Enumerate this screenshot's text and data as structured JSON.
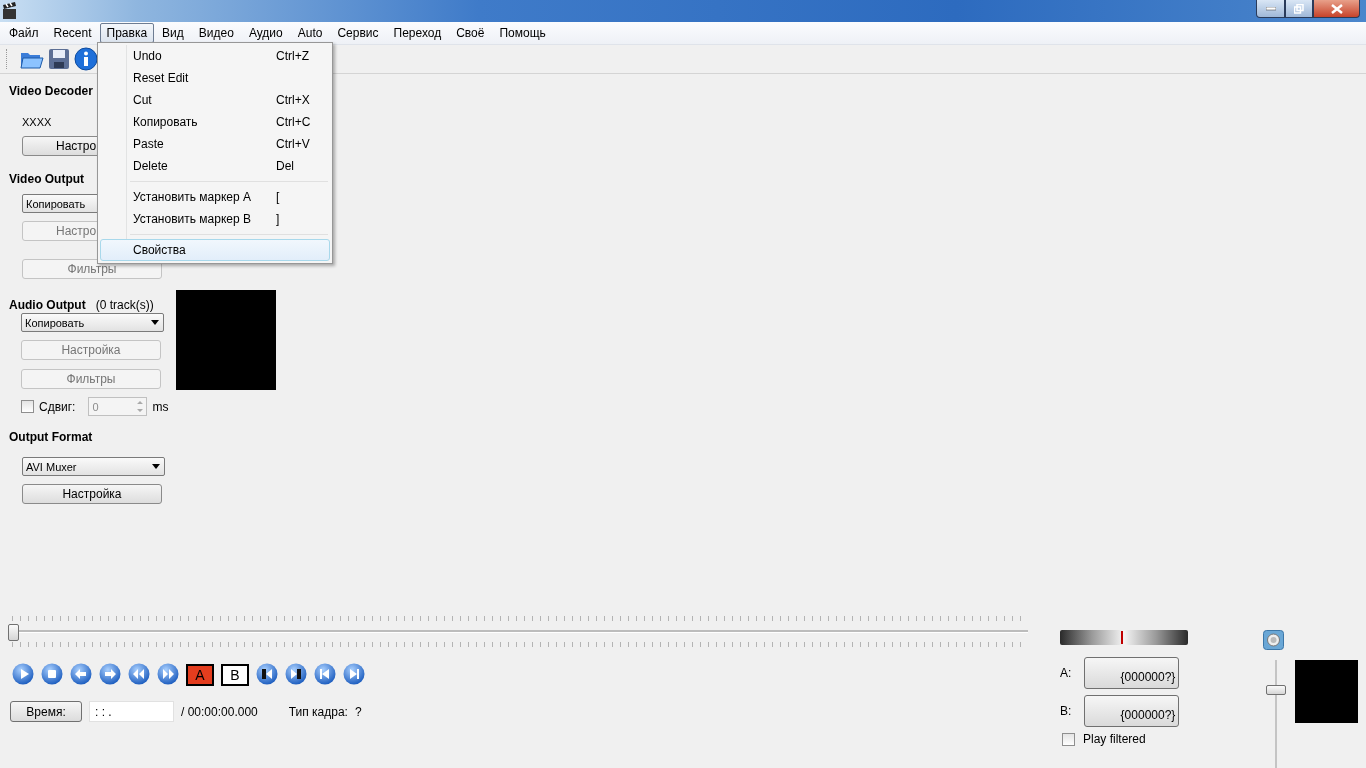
{
  "menubar": [
    {
      "label": "Файл",
      "selected": false
    },
    {
      "label": "Recent",
      "selected": false
    },
    {
      "label": "Правка",
      "selected": true
    },
    {
      "label": "Вид",
      "selected": false
    },
    {
      "label": "Видео",
      "selected": false
    },
    {
      "label": "Аудио",
      "selected": false
    },
    {
      "label": "Auto",
      "selected": false
    },
    {
      "label": "Сервис",
      "selected": false
    },
    {
      "label": "Переход",
      "selected": false
    },
    {
      "label": "Своё",
      "selected": false
    },
    {
      "label": "Помощь",
      "selected": false
    }
  ],
  "edit_menu": [
    {
      "kind": "item",
      "label": "Undo",
      "shortcut": "Ctrl+Z",
      "selected": false
    },
    {
      "kind": "item",
      "label": "Reset Edit",
      "selected": false
    },
    {
      "kind": "item",
      "label": "Cut",
      "shortcut": "Ctrl+X",
      "selected": false
    },
    {
      "kind": "item",
      "label": "Копировать",
      "shortcut": "Ctrl+C",
      "selected": false
    },
    {
      "kind": "item",
      "label": "Paste",
      "shortcut": "Ctrl+V",
      "selected": false
    },
    {
      "kind": "item",
      "label": "Delete",
      "shortcut": "Del",
      "selected": false
    },
    {
      "kind": "separator"
    },
    {
      "kind": "item",
      "label": "Установить маркер A",
      "shortcut": "[",
      "selected": false
    },
    {
      "kind": "item",
      "label": "Установить маркер B",
      "shortcut": "]",
      "selected": false
    },
    {
      "kind": "separator"
    },
    {
      "kind": "item",
      "label": "Свойства",
      "selected": true
    }
  ],
  "video_decoder": {
    "title": "Video Decoder",
    "codec": "XXXX",
    "configure_button": {
      "label": "Настро",
      "disabled": false
    }
  },
  "video_output": {
    "title": "Video Output",
    "codec_select": "Копировать",
    "configure_button": {
      "label": "Настро",
      "disabled": true
    },
    "filters_button": {
      "label": "Фильтры",
      "disabled": true
    }
  },
  "audio_output": {
    "title": "Audio Output",
    "tracks": "(0 track(s))",
    "codec_select": "Копировать",
    "configure_button": {
      "label": "Настройка",
      "disabled": true
    },
    "filters_button": {
      "label": "Фильтры",
      "disabled": true
    },
    "shift": {
      "label": "Сдвиг:",
      "checked": false,
      "value": "0",
      "unit": "ms"
    }
  },
  "output_format": {
    "title": "Output Format",
    "muxer_select": "AVI Muxer",
    "configure_button": {
      "label": "Настройка",
      "disabled": false
    }
  },
  "playback": {
    "position": {
      "level": 0
    },
    "transport": [
      {
        "kind": "play"
      },
      {
        "kind": "stop"
      },
      {
        "kind": "back"
      },
      {
        "kind": "forward"
      },
      {
        "kind": "rewind"
      },
      {
        "kind": "fast-forward"
      },
      {
        "kind": "marker-a",
        "label": "A"
      },
      {
        "kind": "marker-b",
        "label": "B"
      },
      {
        "kind": "go-a"
      },
      {
        "kind": "go-b"
      },
      {
        "kind": "first"
      },
      {
        "kind": "last"
      }
    ],
    "time_button": "Время:",
    "time_field": ": : .",
    "duration": "/ 00:00:00.000",
    "frame_type_label": "Тип кадра:",
    "frame_type": "?"
  },
  "markers": {
    "a_label": "A:",
    "a_value": "{000000?}",
    "b_label": "B:",
    "b_value": "{000000?}",
    "play_filtered": {
      "label": "Play filtered",
      "checked": false
    }
  },
  "volume": {
    "level": 0.75
  }
}
